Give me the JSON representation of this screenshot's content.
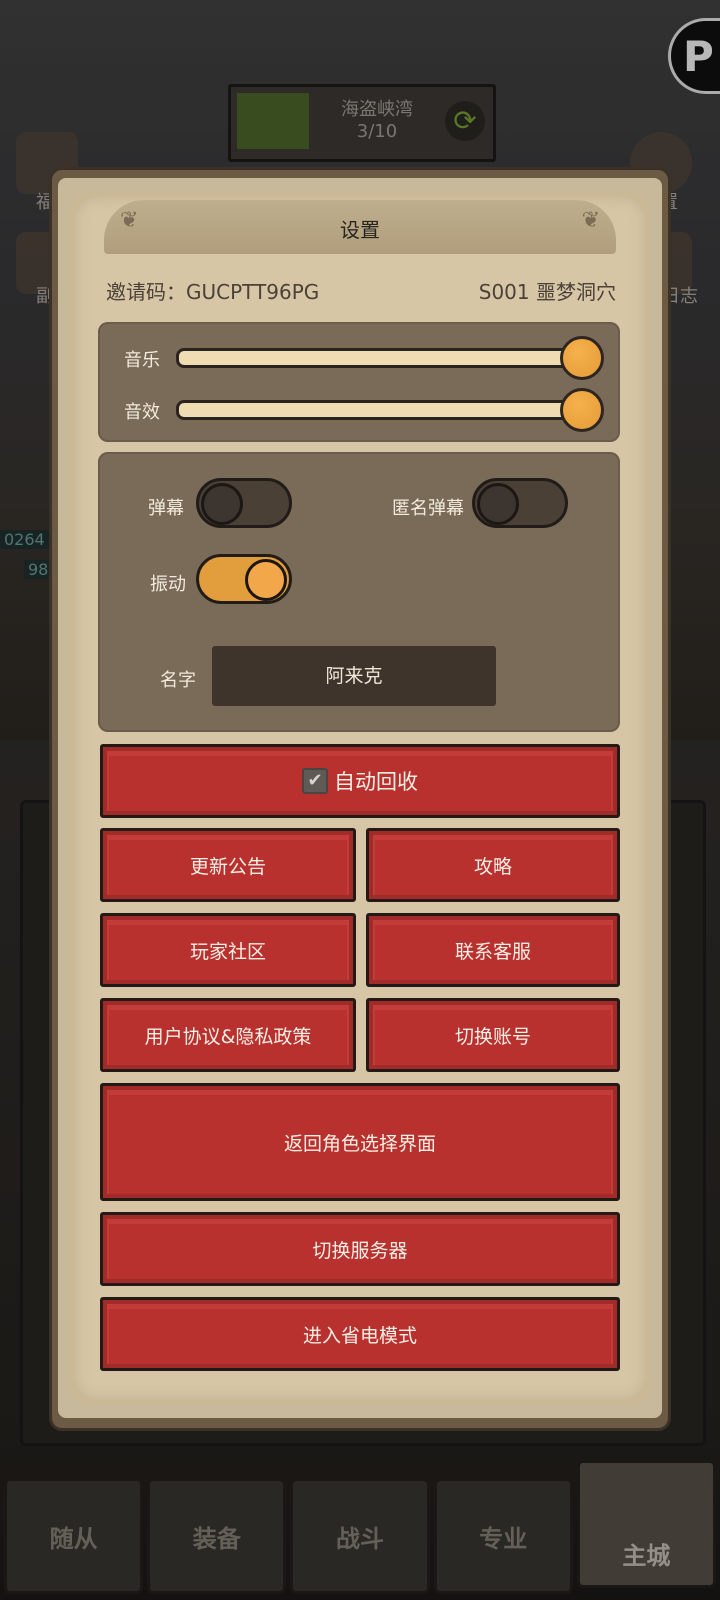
{
  "background": {
    "stage": {
      "name": "海盗峡湾",
      "progress": "3/10",
      "refresh_icon": "refresh-arrows-icon"
    },
    "left_labels": [
      "福",
      "副"
    ],
    "right_labels": [
      "置",
      "日志"
    ],
    "hud_numbers": [
      "0264",
      "98"
    ],
    "corner_button": "P",
    "nav_tabs": [
      "随从",
      "装备",
      "战斗",
      "专业",
      "主城"
    ]
  },
  "modal": {
    "title": "设置",
    "invite_code": "邀请码：GUCPTT96PG",
    "server": "S001 噩梦洞穴",
    "sliders": [
      {
        "label": "音乐",
        "value": 1.0
      },
      {
        "label": "音效",
        "value": 1.0
      }
    ],
    "toggles": {
      "danmaku": {
        "label": "弹幕",
        "on": false
      },
      "anon_danmaku": {
        "label": "匿名弹幕",
        "on": false
      },
      "vibration": {
        "label": "振动",
        "on": true
      }
    },
    "name": {
      "label": "名字",
      "value": "阿来克"
    },
    "auto_recycle": {
      "label": "自动回收",
      "checked": true
    },
    "buttons": {
      "update_notice": "更新公告",
      "guide": "攻略",
      "community": "玩家社区",
      "support": "联系客服",
      "agreement": "用户协议&隐私政策",
      "switch_account": "切换账号",
      "back_to_role": "返回角色选择界面",
      "switch_server": "切换服务器",
      "power_save": "进入省电模式"
    }
  },
  "colors": {
    "button_red": "#b8312f",
    "toggle_on": "#e29d3d",
    "panel": "#7a6b59",
    "paper": "#d6c6a6"
  }
}
